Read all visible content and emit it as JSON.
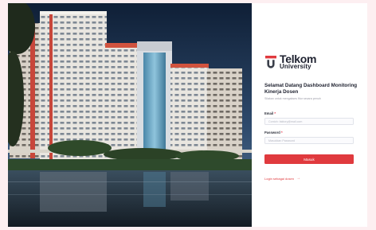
{
  "brand": {
    "name": "Telkom",
    "sub": "University",
    "primary_color": "#E03A3E"
  },
  "login": {
    "welcome_title": "Selamat Datang Dashboard Monitoring Kinerja Dosen",
    "subtitle": "Silakan untuk mengakses fitur secara penuh",
    "email_label": "Email",
    "email_placeholder": "Contoh: faktory@mail.com",
    "password_label": "Password",
    "password_placeholder": "Masukkan Password",
    "required_mark": "*",
    "submit_label": "Masuk",
    "guest_link_label": "Login sebagai dosen",
    "guest_link_icon": "arrow-right-icon"
  },
  "hero": {
    "image": "campus-building-photo"
  }
}
